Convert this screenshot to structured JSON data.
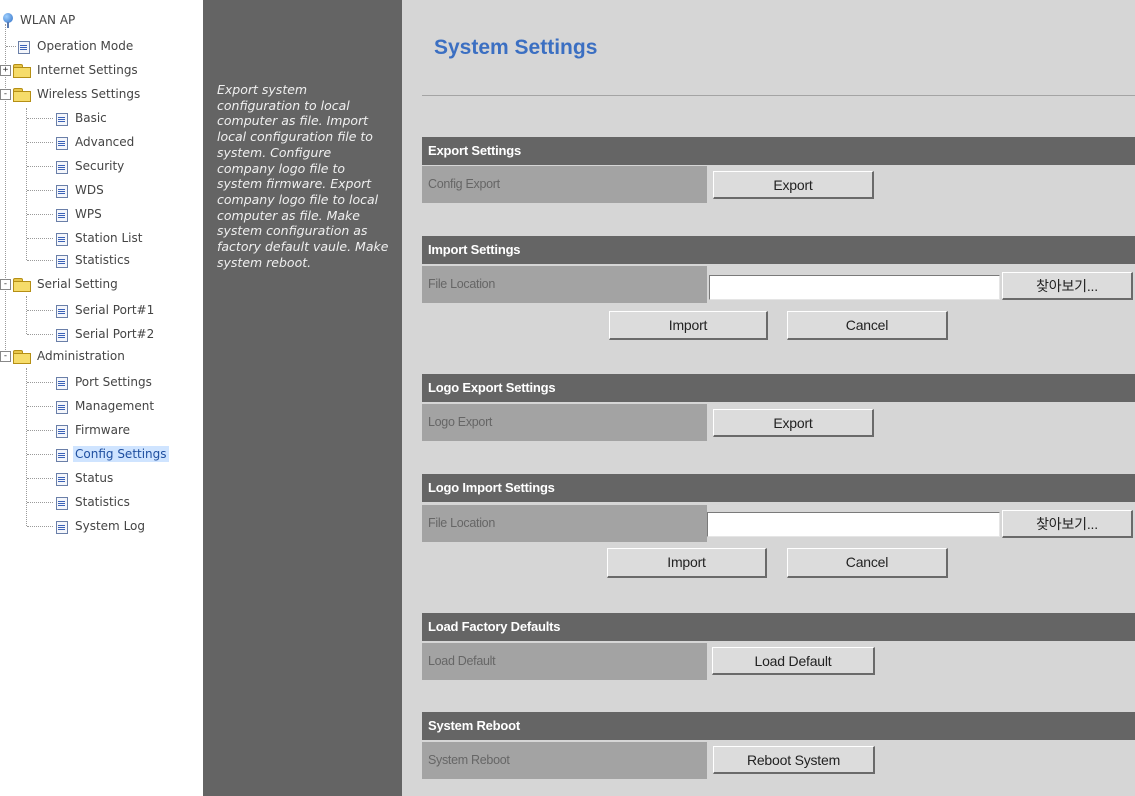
{
  "tree": {
    "root": "WLAN AP",
    "items": {
      "operation_mode": "Operation Mode",
      "internet_settings": "Internet Settings",
      "wireless_settings": "Wireless Settings",
      "basic": "Basic",
      "advanced": "Advanced",
      "security": "Security",
      "wds": "WDS",
      "wps": "WPS",
      "station_list": "Station List",
      "wireless_statistics": "Statistics",
      "serial_setting": "Serial Setting",
      "serial_port1": "Serial Port#1",
      "serial_port2": "Serial Port#2",
      "administration": "Administration",
      "port_settings": "Port Settings",
      "management": "Management",
      "firmware": "Firmware",
      "config_settings": "Config Settings",
      "status": "Status",
      "admin_statistics": "Statistics",
      "system_log": "System Log"
    },
    "selected": "Config Settings",
    "expander_plus": "+",
    "expander_minus": "-"
  },
  "help": {
    "text": "Export system configuration to local computer as file. Import local configuration file to system. Configure company logo file to system firmware. Export company logo file to local computer as file. Make system configuration as factory default vaule. Make system reboot."
  },
  "page": {
    "title": "System Settings"
  },
  "sections": {
    "export": {
      "header": "Export Settings",
      "label": "Config Export",
      "button": "Export"
    },
    "import": {
      "header": "Import Settings",
      "label": "File Location",
      "browse": "찾아보기...",
      "file_value": "",
      "import_button": "Import",
      "cancel_button": "Cancel"
    },
    "logo_export": {
      "header": "Logo Export Settings",
      "label": "Logo Export",
      "button": "Export"
    },
    "logo_import": {
      "header": "Logo Import Settings",
      "label": "File Location",
      "browse": "찾아보기...",
      "file_value": "",
      "import_button": "Import",
      "cancel_button": "Cancel"
    },
    "factory": {
      "header": "Load Factory Defaults",
      "label": "Load Default",
      "button": "Load Default"
    },
    "reboot": {
      "header": "System Reboot",
      "label": "System Reboot",
      "button": "Reboot System"
    }
  },
  "colors": {
    "title": "#3b6fc2",
    "section_header": "#656565",
    "help_panel": "#646464",
    "main_bg": "#d6d6d6"
  }
}
